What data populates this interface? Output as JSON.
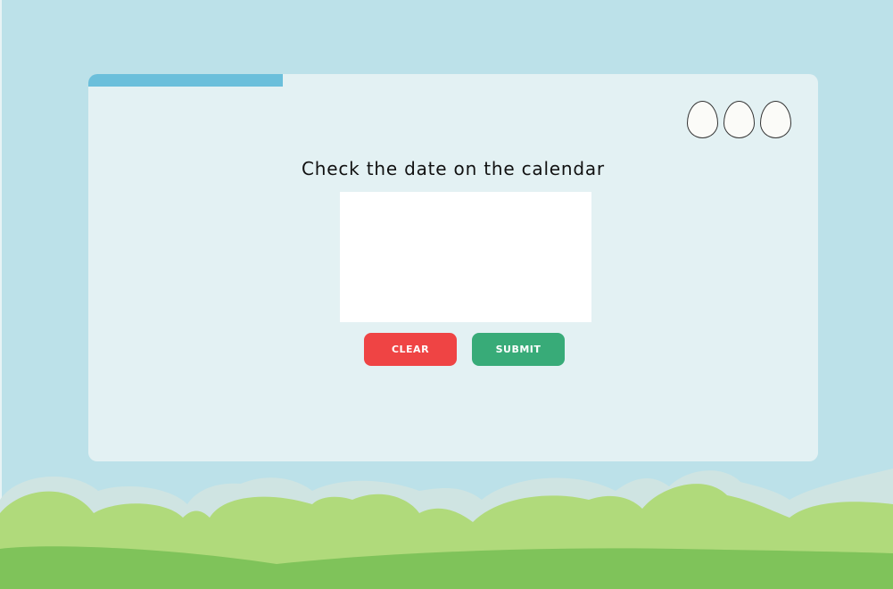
{
  "progress": {
    "fraction": 0.267
  },
  "lives": {
    "count": 3,
    "icon": "egg-icon"
  },
  "question": {
    "prompt": "Check the date on the calendar"
  },
  "buttons": {
    "clear_label": "CLEAR",
    "submit_label": "SUBMIT"
  },
  "colors": {
    "sky": "#bce1e9",
    "card": "#e3f1f3",
    "progress": "#6bbfdb",
    "clear": "#ef4444",
    "submit": "#38ab78",
    "grass_dark": "#7fc35a",
    "grass_light": "#b0da7b"
  }
}
